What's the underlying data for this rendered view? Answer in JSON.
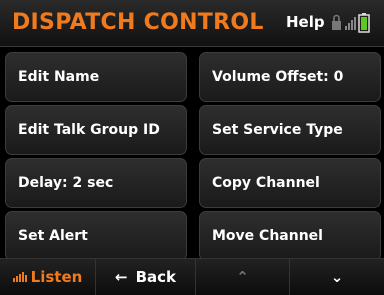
{
  "header": {
    "title": "DISPATCH CONTROL",
    "help_label": "Help"
  },
  "menu": {
    "edit_name": "Edit Name",
    "volume_offset": "Volume Offset: 0",
    "edit_talk_group_id": "Edit Talk Group ID",
    "set_service_type": "Set Service Type",
    "delay": "Delay: 2 sec",
    "copy_channel": "Copy Channel",
    "set_alert": "Set Alert",
    "move_channel": "Move Channel"
  },
  "footer": {
    "listen_label": "Listen",
    "back_label": "Back",
    "back_glyph": "←",
    "up_glyph": "⌃",
    "down_glyph": "⌄"
  },
  "colors": {
    "accent": "#f07b1f",
    "battery": "#5fc81e"
  },
  "icons": [
    "lock-icon",
    "signal-bars-icon",
    "battery-icon",
    "audio-level-icon",
    "back-arrow-icon",
    "chevron-up-icon",
    "chevron-down-icon"
  ]
}
